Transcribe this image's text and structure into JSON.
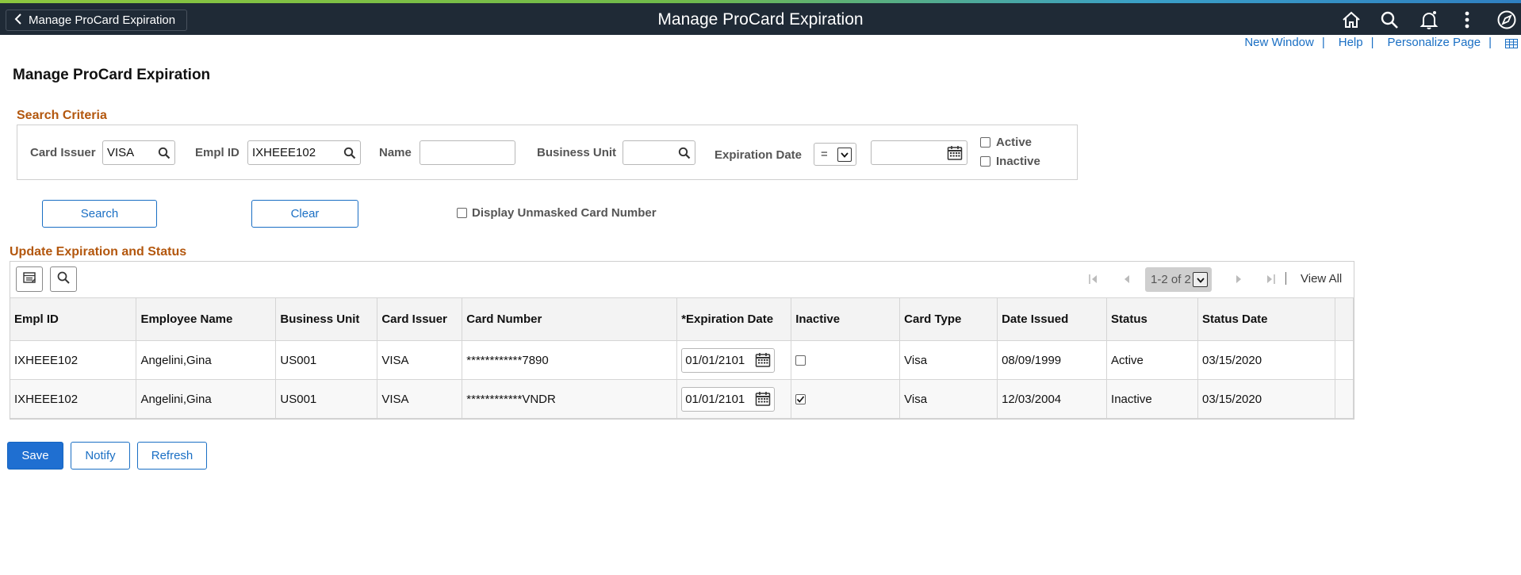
{
  "header": {
    "back_label": "Manage ProCard Expiration",
    "title": "Manage ProCard Expiration"
  },
  "util_links": {
    "new_window": "New Window",
    "help": "Help",
    "personalize": "Personalize Page",
    "separator": "|"
  },
  "page_title": "Manage ProCard Expiration",
  "search_criteria": {
    "section_label": "Search Criteria",
    "card_issuer_label": "Card Issuer",
    "card_issuer_value": "VISA",
    "empl_id_label": "Empl ID",
    "empl_id_value": "IXHEEE102",
    "name_label": "Name",
    "name_value": "",
    "business_unit_label": "Business Unit",
    "business_unit_value": "",
    "expiration_date_label": "Expiration Date",
    "expiration_operator": "=",
    "expiration_date_value": "",
    "active_label": "Active",
    "active_checked": false,
    "inactive_label": "Inactive",
    "inactive_checked": false
  },
  "actions": {
    "search": "Search",
    "clear": "Clear",
    "display_unmasked_label": "Display Unmasked Card Number",
    "display_unmasked_checked": false
  },
  "grid": {
    "section_label": "Update Expiration and Status",
    "pager_text": "1-2 of 2",
    "view_all": "View All",
    "columns": [
      "Empl ID",
      "Employee Name",
      "Business Unit",
      "Card Issuer",
      "Card Number",
      "*Expiration Date",
      "Inactive",
      "Card Type",
      "Date Issued",
      "Status",
      "Status Date"
    ],
    "rows": [
      {
        "empl_id": "IXHEEE102",
        "employee_name": "Angelini,Gina",
        "business_unit": "US001",
        "card_issuer": "VISA",
        "card_number": "************7890",
        "expiration_date": "01/01/2101",
        "inactive": false,
        "card_type": "Visa",
        "date_issued": "08/09/1999",
        "status": "Active",
        "status_date": "03/15/2020"
      },
      {
        "empl_id": "IXHEEE102",
        "employee_name": "Angelini,Gina",
        "business_unit": "US001",
        "card_issuer": "VISA",
        "card_number": "************VNDR",
        "expiration_date": "01/01/2101",
        "inactive": true,
        "card_type": "Visa",
        "date_issued": "12/03/2004",
        "status": "Inactive",
        "status_date": "03/15/2020"
      }
    ]
  },
  "footer": {
    "save": "Save",
    "notify": "Notify",
    "refresh": "Refresh"
  },
  "colors": {
    "banner": "#1f2a36",
    "section_label": "#b3570e",
    "link": "#1a6fc4",
    "primary_button": "#1f6fd1"
  }
}
